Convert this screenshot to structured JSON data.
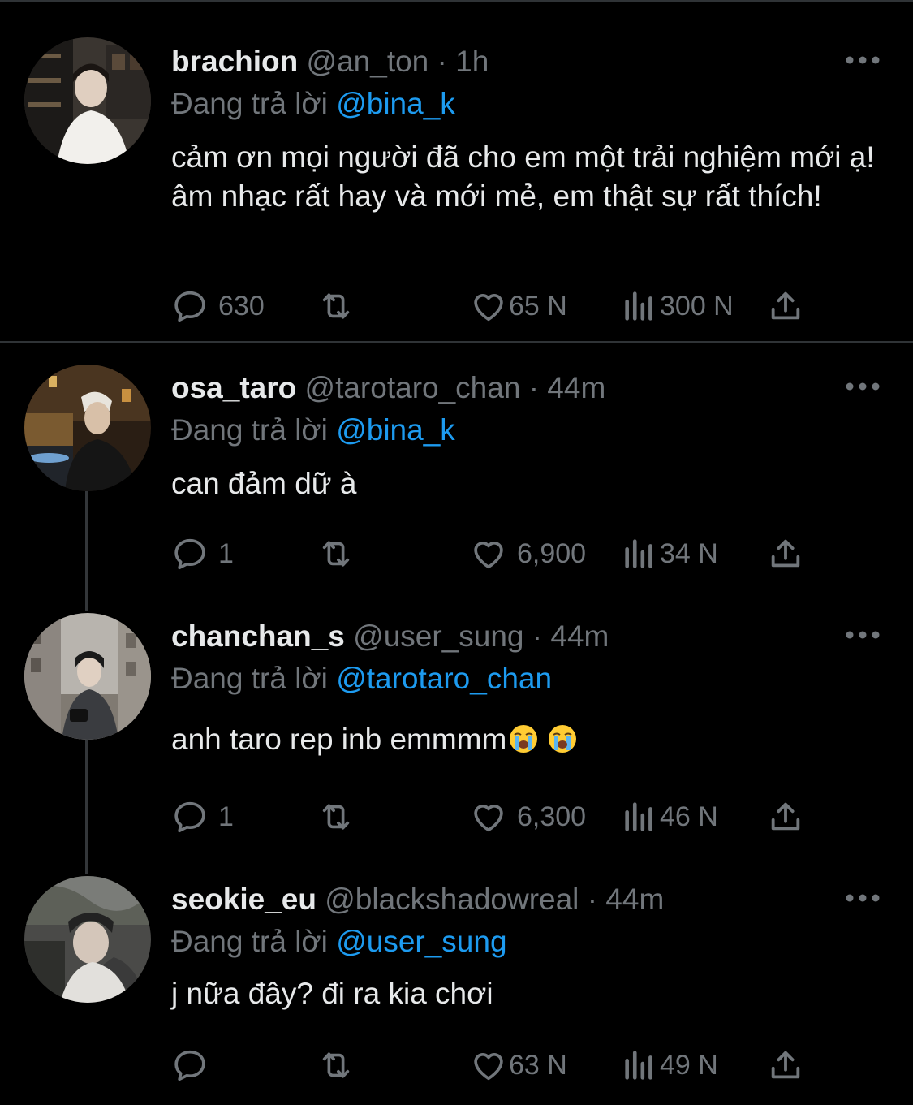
{
  "tweets": [
    {
      "name": "brachion",
      "handle": "@an_ton",
      "time": "1h",
      "reply_prefix": "Đang trả lời",
      "reply_to": "@bina_k",
      "text": "cảm ơn mọi người đã cho em một trải nghiệm mới ạ! âm nhạc rất hay và mới mẻ, em thật sự rất thích!",
      "replies": "630",
      "retweets": "",
      "likes": "65 N",
      "views": "300 N"
    },
    {
      "name": "osa_taro",
      "handle": "@tarotaro_chan",
      "time": "44m",
      "reply_prefix": "Đang trả lời",
      "reply_to": "@bina_k",
      "text": "can đảm dữ à",
      "replies": "1",
      "retweets": "",
      "likes": "6,900",
      "views": "34 N"
    },
    {
      "name": "chanchan_s",
      "handle": "@user_sung",
      "time": "44m",
      "reply_prefix": "Đang trả lời",
      "reply_to": "@tarotaro_chan",
      "text": "anh taro rep inb emmmm",
      "text_emojis": [
        "loudly-crying-face",
        "loudly-crying-face"
      ],
      "replies": "1",
      "retweets": "",
      "likes": "6,300",
      "views": "46 N"
    },
    {
      "name": "seokie_eu",
      "handle": "@blackshadowreal",
      "time": "44m",
      "reply_prefix": "Đang trả lời",
      "reply_to": "@user_sung",
      "text": "j nữa đây? đi ra kia chơi",
      "replies": "",
      "retweets": "",
      "likes": "63 N",
      "views": "49 N"
    }
  ],
  "icons": [
    "reply-icon",
    "retweet-icon",
    "like-icon",
    "views-icon",
    "share-icon",
    "more-icon"
  ],
  "colors": {
    "background": "#000000",
    "text": "#e7e9ea",
    "muted": "#71767b",
    "link": "#1d9bf0"
  }
}
